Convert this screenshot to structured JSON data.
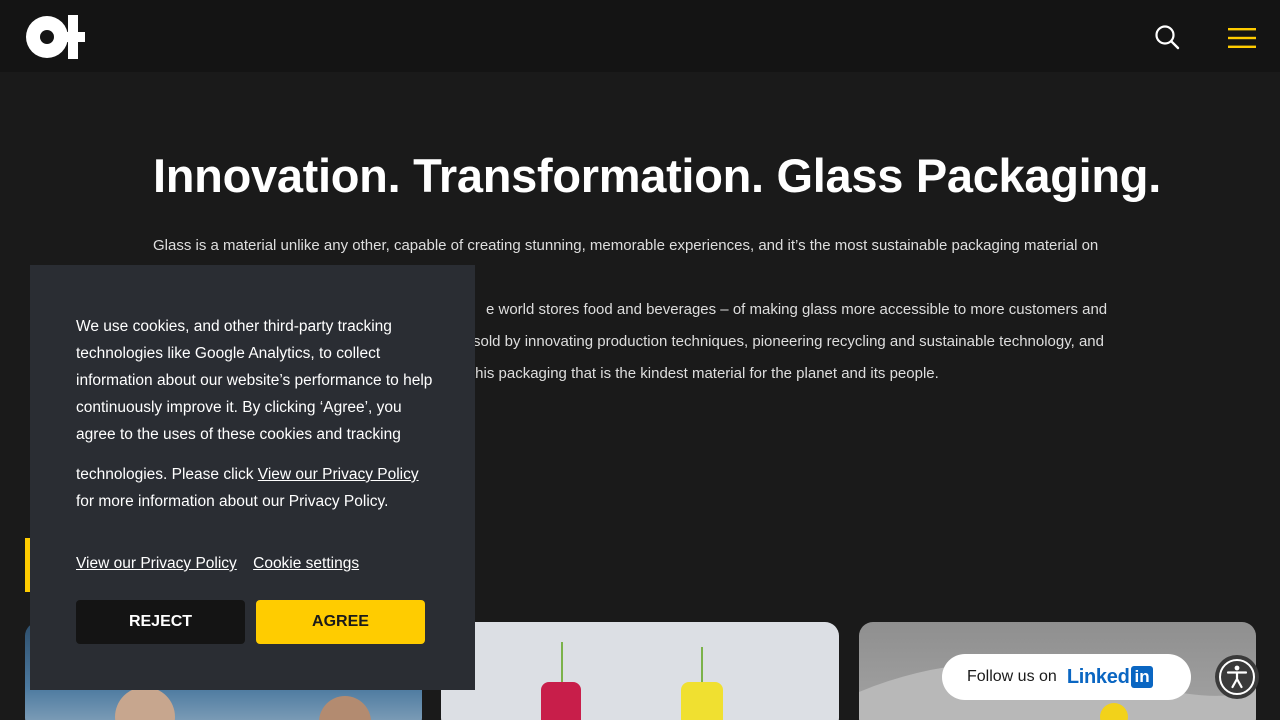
{
  "header": {
    "logo": "O-I",
    "search_icon": "search-icon",
    "menu_icon": "hamburger-menu-icon",
    "accent_color": "#ffcc00"
  },
  "hero": {
    "title": "Innovation. Transformation. Glass Packaging.",
    "lines": [
      "Glass is a material unlike any other, capable of creating stunning, memorable experiences, and it’s the most sustainable packaging material on earth.",
      "e world stores food and beverages – of making glass more accessible to more customers and",
      "sold by innovating production techniques, pioneering recycling and sustainable technology, and",
      "this packaging that is the kindest material for the planet and its people."
    ]
  },
  "cookie": {
    "text_1": "We use cookies, and other third-party tracking technologies like Google Analytics, to collect information about our website’s performance to help continuously improve it. By clicking ‘Agree’, you agree to the uses of these cookies and tracking",
    "text_2_before": "technologies. Please click ",
    "text_2_link": "View our Privacy Policy",
    "text_2_after": " for more information about our Privacy Policy.",
    "privacy_link": "View our Privacy Policy",
    "settings_link": "Cookie settings",
    "reject_label": "REJECT",
    "agree_label": "AGREE"
  },
  "social": {
    "follow_label": "Follow us on",
    "linkedin_word": "Linked",
    "linkedin_box": "in"
  },
  "accessibility": {
    "icon": "accessibility-icon"
  }
}
